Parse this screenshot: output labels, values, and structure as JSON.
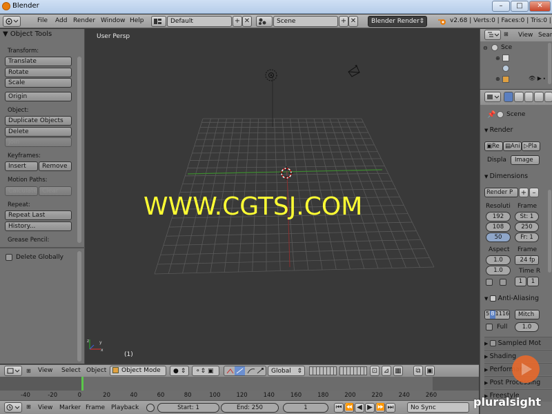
{
  "window": {
    "title": "Blender",
    "min": "–",
    "max": "□",
    "close": "✕"
  },
  "info_header": {
    "menus": [
      "File",
      "Add",
      "Render",
      "Window",
      "Help"
    ],
    "screen_layout": "Default",
    "scene": "Scene",
    "render_engine": "Blender Render",
    "stats": "v2.68 | Verts:0 | Faces:0 | Tris:0 | Obje"
  },
  "tool_panel": {
    "title": "Object Tools",
    "transform_label": "Transform:",
    "translate": "Translate",
    "rotate": "Rotate",
    "scale": "Scale",
    "origin": "Origin",
    "object_label": "Object:",
    "duplicate": "Duplicate Objects",
    "delete": "Delete",
    "join": "Join",
    "keyframes_label": "Keyframes:",
    "insert": "Insert",
    "remove": "Remove",
    "motion_paths_label": "Motion Paths:",
    "calculate": "Calculate",
    "clear": "Clear",
    "repeat_label": "Repeat:",
    "repeat_last": "Repeat Last",
    "history": "History...",
    "grease_pencil_label": "Grease Pencil:",
    "delete_globally": "Delete Globally"
  },
  "viewport": {
    "view_name": "User Persp",
    "frame_indicator": "(1)",
    "watermark": "WWW.CGTSJ.COM"
  },
  "viewport_header": {
    "menus": [
      "View",
      "Select",
      "Object"
    ],
    "mode": "Object Mode",
    "orientation": "Global"
  },
  "timeline": {
    "ticks": [
      "-40",
      "-20",
      "0",
      "20",
      "40",
      "60",
      "80",
      "100",
      "120",
      "140",
      "160",
      "180",
      "200",
      "220",
      "240",
      "260"
    ],
    "current_frame_marker": 0,
    "menus": [
      "View",
      "Marker",
      "Frame",
      "Playback"
    ],
    "start": "Start: 1",
    "end": "End: 250",
    "current": "1",
    "sync": "No Sync"
  },
  "outliner": {
    "view_label": "View",
    "search_label": "Search",
    "scene_item": "Sce"
  },
  "properties": {
    "context_scene": "Scene",
    "render_section": "Render",
    "render_btn": "Re",
    "anim_btn": "Ani",
    "play_btn": "Pla",
    "display_label": "Displa",
    "display_value": "Image",
    "dimensions_section": "Dimensions",
    "preset": "Render P",
    "resolution_label": "Resoluti",
    "res_x": "192",
    "res_y": "108",
    "res_pct": "50",
    "frame_range_label": "Frame",
    "start": "St: 1",
    "end": "250",
    "step": "Fr: 1",
    "aspect_label": "Aspect",
    "aspect_x": "1.0",
    "aspect_y": "1.0",
    "frame_rate_label": "Frame",
    "fps": "24 fp",
    "time_remap_label": "Time R",
    "time_old": "1",
    "time_new": "1",
    "aa_section": "Anti-Aliasing",
    "aa_samples": [
      "5",
      "8",
      "11",
      "16"
    ],
    "aa_filter": "Mitch",
    "full_label": "Full",
    "filter_size": "1.0",
    "sampled_motion": "Sampled Mot",
    "shading": "Shading",
    "performance": "Performance",
    "post_processing": "Post Processing",
    "freestyle": "Freestyle"
  },
  "branding": {
    "pluralsight": "pluralsight"
  }
}
